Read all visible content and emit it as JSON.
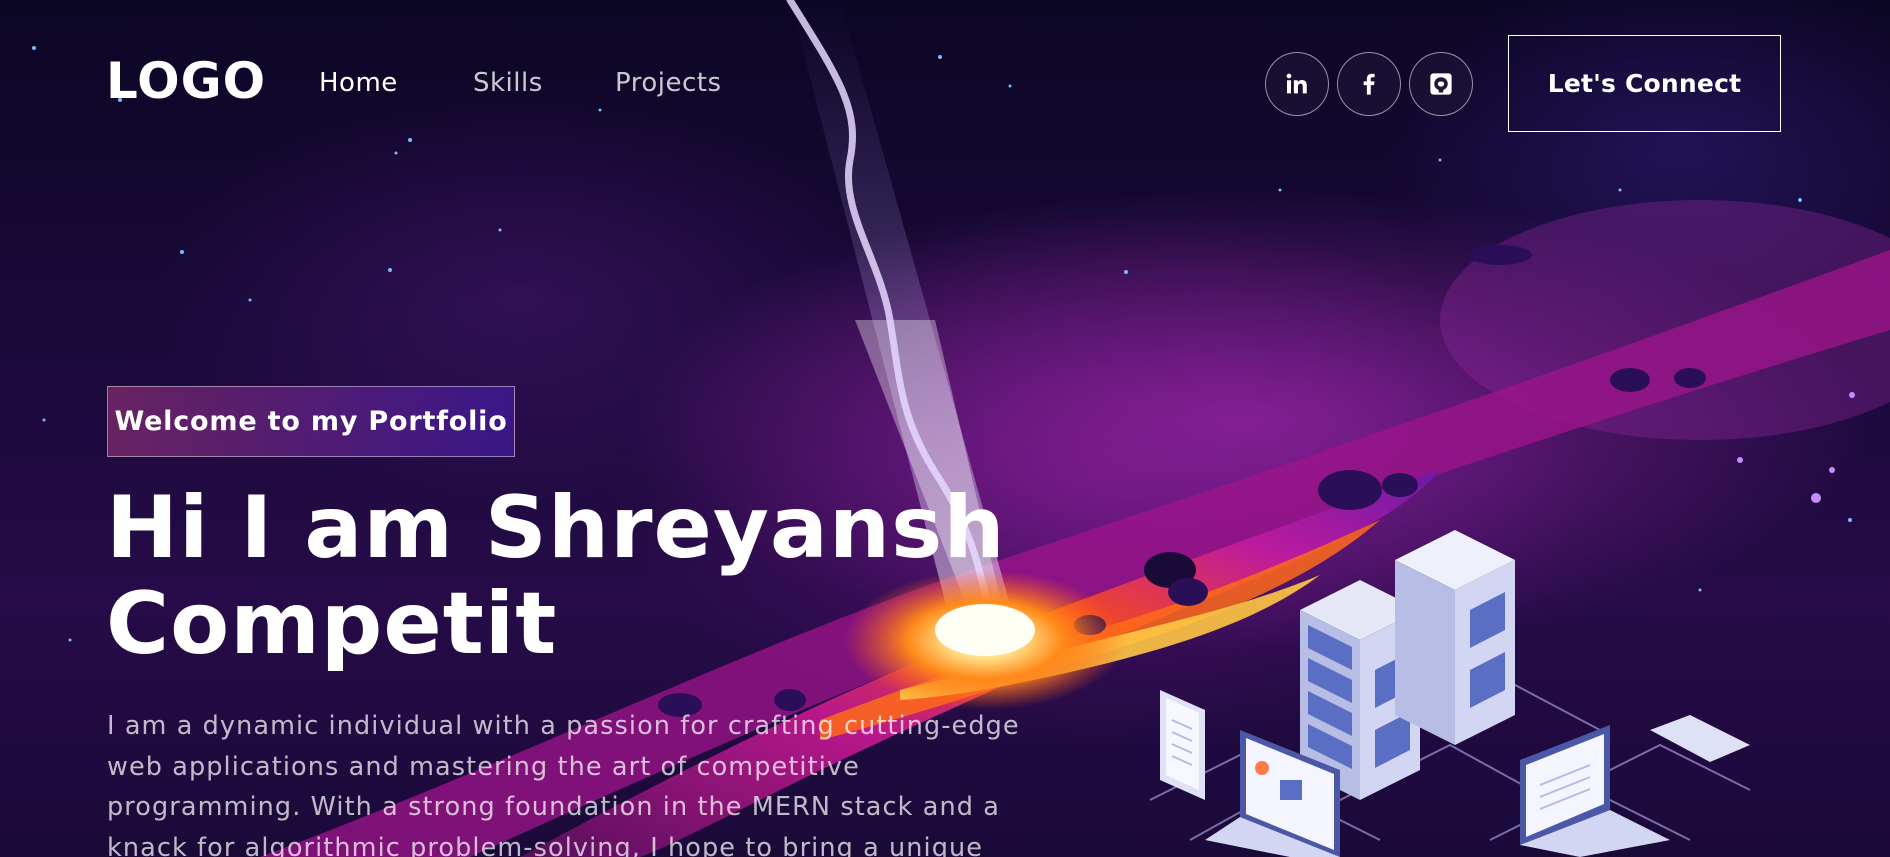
{
  "brand": {
    "logo": "LOGO"
  },
  "nav": {
    "links": [
      {
        "label": "Home"
      },
      {
        "label": "Skills"
      },
      {
        "label": "Projects"
      }
    ],
    "social": [
      {
        "icon": "linkedin-icon"
      },
      {
        "icon": "facebook-icon"
      },
      {
        "icon": "github-icon"
      }
    ],
    "cta": "Let's Connect"
  },
  "hero": {
    "tagline": "Welcome to my Portfolio",
    "headline_line1": "Hi I am Shreyansh",
    "headline_line2": "Competit",
    "bio": "I am a dynamic individual with a passion for crafting cutting-edge web applications and mastering the art of competitive programming. With a strong foundation in the MERN stack and a knack for algorithmic problem-solving, I hope to bring a unique",
    "illustration": "server-network-illustration"
  },
  "colors": {
    "background": "#0f0828",
    "accent_pink": "#aa367c",
    "accent_violet": "#4a2fbd",
    "nebula_orange": "#ff6a1a",
    "nebula_magenta": "#c21aa0"
  }
}
